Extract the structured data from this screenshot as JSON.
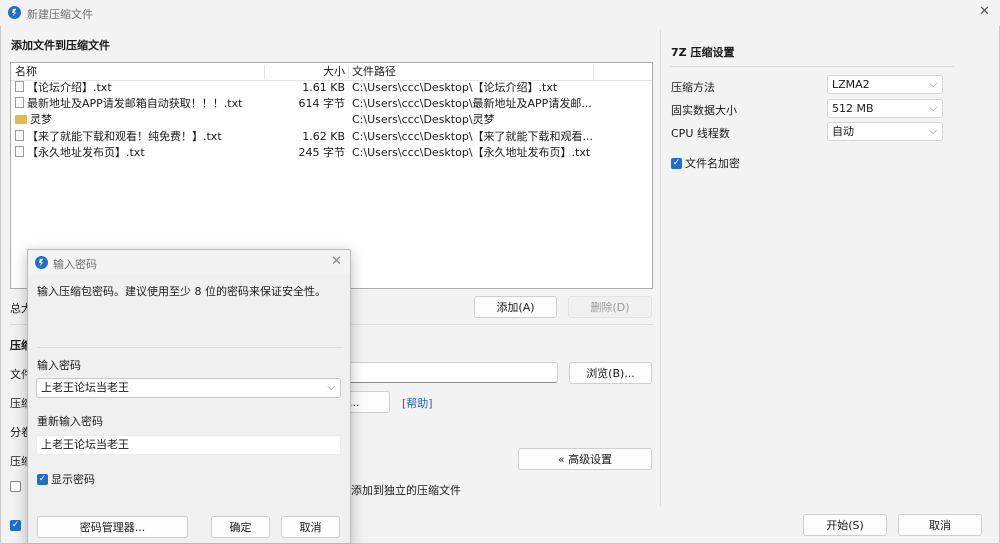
{
  "window": {
    "title": "新建压缩文件",
    "close": "✕"
  },
  "main": {
    "section_title": "添加文件到压缩文件",
    "columns": {
      "name": "名称",
      "size": "大小",
      "path": "文件路径"
    },
    "files": [
      {
        "type": "file",
        "name": "【论坛介绍】.txt",
        "size": "1.61 KB",
        "path": "C:\\Users\\ccc\\Desktop\\【论坛介绍】.txt"
      },
      {
        "type": "file",
        "name": "最新地址及APP请发邮箱自动获取！！！.txt",
        "size": "614 字节",
        "path": "C:\\Users\\ccc\\Desktop\\最新地址及APP请发邮..."
      },
      {
        "type": "folder",
        "name": "灵梦",
        "size": "",
        "path": "C:\\Users\\ccc\\Desktop\\灵梦"
      },
      {
        "type": "file",
        "name": "【来了就能下载和观看！纯免费！】.txt",
        "size": "1.62 KB",
        "path": "C:\\Users\\ccc\\Desktop\\【来了就能下载和观看..."
      },
      {
        "type": "file",
        "name": "【永久地址发布页】.txt",
        "size": "245 字节",
        "path": "C:\\Users\\ccc\\Desktop\\【永久地址发布页】.txt"
      }
    ],
    "total_label_partial": "总大",
    "add_button": "添加(A)",
    "delete_button": "删除(D)",
    "archive_section_partial": "压缩",
    "file_label_partial": "文件",
    "format_label_partial": "压缩",
    "split_label_partial": "分卷",
    "level_label_partial": "压缩",
    "browse_button": "浏览(B)...",
    "ellipsis_button": "...",
    "help_link": "[帮助]",
    "advanced_button": "« 高级设置",
    "separate_checkbox_text": "夹添加到独立的压缩文件",
    "start_button": "开始(S)",
    "cancel_button": "取消"
  },
  "settings7z": {
    "title": "7Z 压缩设置",
    "method_label": "压缩方法",
    "method_value": "LZMA2",
    "dict_label": "固实数据大小",
    "dict_value": "512 MB",
    "threads_label": "CPU 线程数",
    "threads_value": "自动",
    "encrypt_names_label": "文件名加密"
  },
  "dialog": {
    "title": "输入密码",
    "close": "✕",
    "info": "输入压缩包密码。建议使用至少 8 位的密码来保证安全性。",
    "password_label": "输入密码",
    "password_value": "上老王论坛当老王",
    "confirm_label": "重新输入密码",
    "confirm_value": "上老王论坛当老王",
    "show_password_label": "显示密码",
    "manager_button": "密码管理器...",
    "ok_button": "确定",
    "cancel_button": "取消"
  }
}
